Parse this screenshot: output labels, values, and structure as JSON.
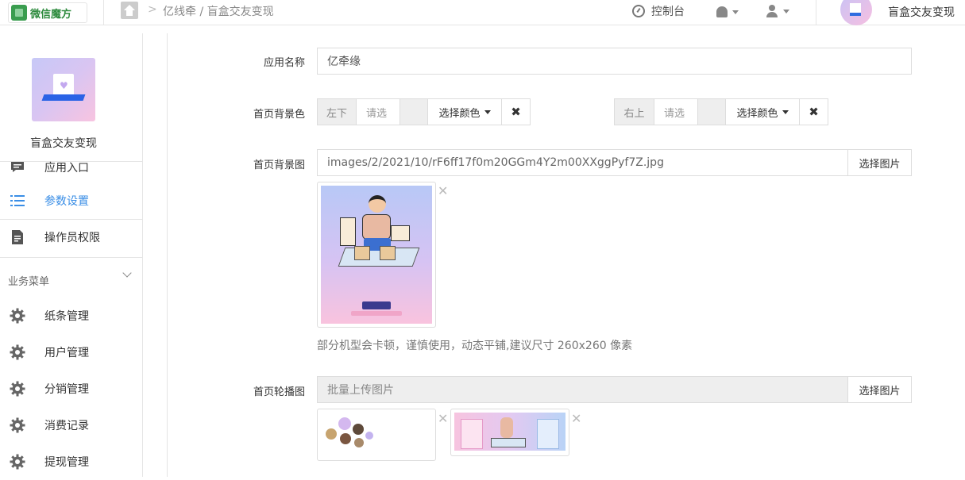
{
  "topbar": {
    "brand": "微信魔方",
    "breadcrumb": "亿线牵 / 盲盒交友变现",
    "console_label": "控制台",
    "user_name": "盲盒交友变现"
  },
  "sidebar": {
    "app_name": "盲盒交友变现",
    "items": [
      {
        "label": "应用入口",
        "icon": "chat-icon"
      },
      {
        "label": "参数设置",
        "icon": "list-icon",
        "active": true
      },
      {
        "label": "操作员权限",
        "icon": "document-icon"
      }
    ],
    "section_title": "业务菜单",
    "business_items": [
      {
        "label": "纸条管理",
        "icon": "gear-icon"
      },
      {
        "label": "用户管理",
        "icon": "gear-icon"
      },
      {
        "label": "分销管理",
        "icon": "gear-icon"
      },
      {
        "label": "消费记录",
        "icon": "gear-icon"
      },
      {
        "label": "提现管理",
        "icon": "gear-icon"
      }
    ]
  },
  "form": {
    "app_name": {
      "label": "应用名称",
      "value": "亿牵缘"
    },
    "bg_color": {
      "label": "首页背景色",
      "left": {
        "prefix": "左下",
        "placeholder": "请选",
        "button": "选择颜色"
      },
      "right": {
        "prefix": "右上",
        "placeholder": "请选",
        "button": "选择颜色"
      }
    },
    "bg_image": {
      "label": "首页背景图",
      "value": "images/2/2021/10/rF6ff17f0m20GGm4Y2m00XXggPyf7Z.jpg",
      "button": "选择图片",
      "hint": "部分机型会卡顿，谨慎使用，动态平铺,建议尺寸 260x260 像素"
    },
    "carousel": {
      "label": "首页轮播图",
      "placeholder": "批量上传图片",
      "button": "选择图片"
    }
  },
  "colors": {
    "accent": "#3a8ee6",
    "brand_green": "#2e8b3e"
  }
}
